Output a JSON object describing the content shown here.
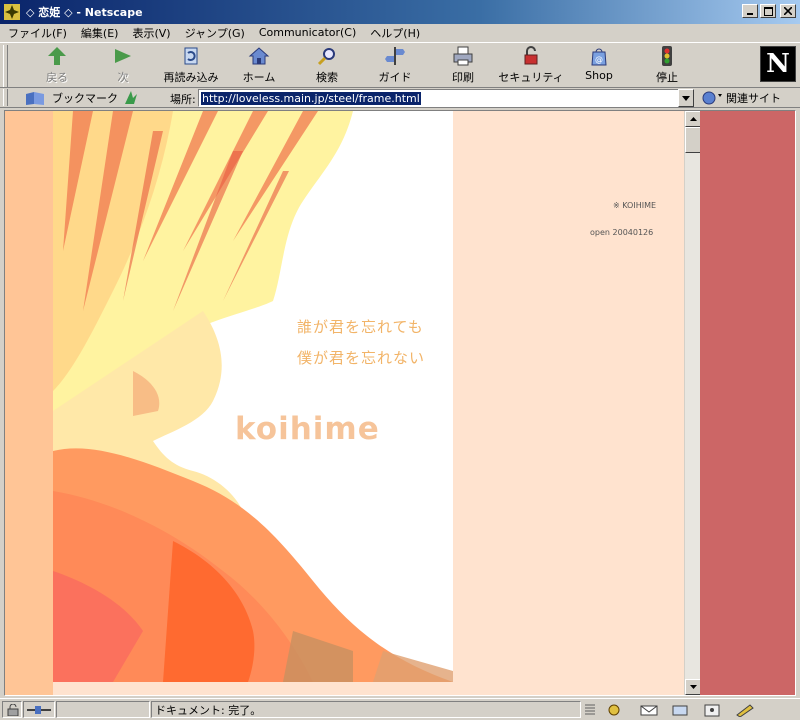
{
  "window": {
    "title": "◇ 恋姫 ◇ - Netscape",
    "controls": {
      "minimize": "_",
      "maximize": "□",
      "close": "×"
    }
  },
  "menu": [
    "ファイル(F)",
    "編集(E)",
    "表示(V)",
    "ジャンプ(G)",
    "Communicator(C)",
    "ヘルプ(H)"
  ],
  "toolbar": {
    "buttons": [
      {
        "label": "戻る",
        "icon": "back-arrow-icon",
        "enabled": false
      },
      {
        "label": "次",
        "icon": "forward-arrow-icon",
        "enabled": false
      },
      {
        "label": "再読み込み",
        "icon": "reload-icon",
        "enabled": true
      },
      {
        "label": "ホーム",
        "icon": "home-icon",
        "enabled": true
      },
      {
        "label": "検索",
        "icon": "search-icon",
        "enabled": true
      },
      {
        "label": "ガイド",
        "icon": "guide-icon",
        "enabled": true
      },
      {
        "label": "印刷",
        "icon": "print-icon",
        "enabled": true
      },
      {
        "label": "セキュリティ",
        "icon": "security-lock-icon",
        "enabled": true
      },
      {
        "label": "Shop",
        "icon": "shop-bag-icon",
        "enabled": true
      },
      {
        "label": "停止",
        "icon": "stop-icon",
        "enabled": true
      }
    ],
    "logo_letter": "N"
  },
  "location_bar": {
    "bookmarks_label": "ブックマーク",
    "location_label": "場所:",
    "url": "http://loveless.main.jp/steel/frame.html",
    "related_label": "関連サイト"
  },
  "page": {
    "poem_lines": [
      "誰が君を忘れても",
      "僕が君を忘れない"
    ],
    "brand": "koihime",
    "copyright": "※ KOIHIME",
    "open_date": "open 20040126"
  },
  "colors": {
    "left_frame_bg": "#ffe3cf",
    "left_strip": "#ffc596",
    "right_frame_bg": "#cc6666",
    "poem_text": "#f2b468",
    "brand_text": "#f6c49a",
    "title_gradient_start": "#0a246a"
  },
  "status_bar": {
    "text": "ドキュメント: 完了。"
  }
}
